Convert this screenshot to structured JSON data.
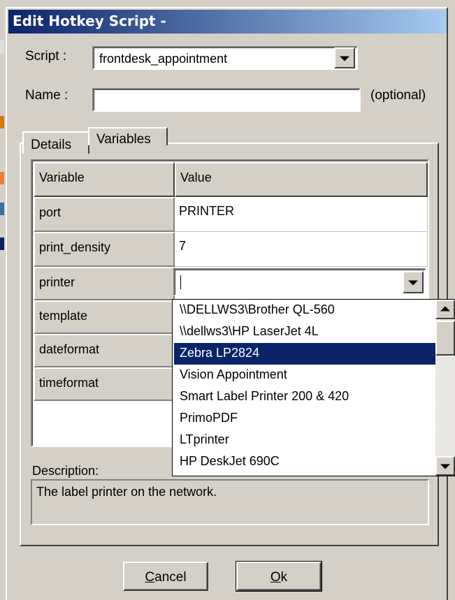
{
  "dialog": {
    "title": "Edit Hotkey Script -",
    "script_label": "Script :",
    "script_value": "frontdesk_appointment",
    "name_label": "Name :",
    "name_value": "",
    "optional_label": "(optional)"
  },
  "tabs": [
    {
      "label": "Details",
      "active": false
    },
    {
      "label": "Variables",
      "active": true
    }
  ],
  "grid": {
    "headers": [
      "Variable",
      "Value"
    ],
    "rows": [
      {
        "name": "port",
        "value": "PRINTER"
      },
      {
        "name": "print_density",
        "value": "7"
      },
      {
        "name": "printer",
        "value": ""
      },
      {
        "name": "template",
        "value": ""
      },
      {
        "name": "dateformat",
        "value": ""
      },
      {
        "name": "timeformat",
        "value": ""
      }
    ]
  },
  "printer_dropdown": {
    "options": [
      "\\\\DELLWS3\\Brother QL-560",
      "\\\\dellws3\\HP LaserJet 4L",
      "Zebra  LP2824",
      "Vision Appointment",
      "Smart Label Printer 200 & 420",
      "PrimoPDF",
      "LTprinter",
      "HP DeskJet 690C"
    ],
    "selected_index": 2
  },
  "description": {
    "label": "Description:",
    "text": "The label printer on the network."
  },
  "buttons": {
    "cancel_prefix": "C",
    "cancel_rest": "ancel",
    "ok_prefix": "O",
    "ok_rest": "k"
  },
  "colors": {
    "title_gradient_start": "#0a246a",
    "title_gradient_end": "#a6caf0",
    "selection": "#0a246a",
    "face": "#d4d0c8"
  },
  "icons": [
    "dropdown-arrow-icon",
    "scroll-up-icon",
    "scroll-down-icon"
  ]
}
